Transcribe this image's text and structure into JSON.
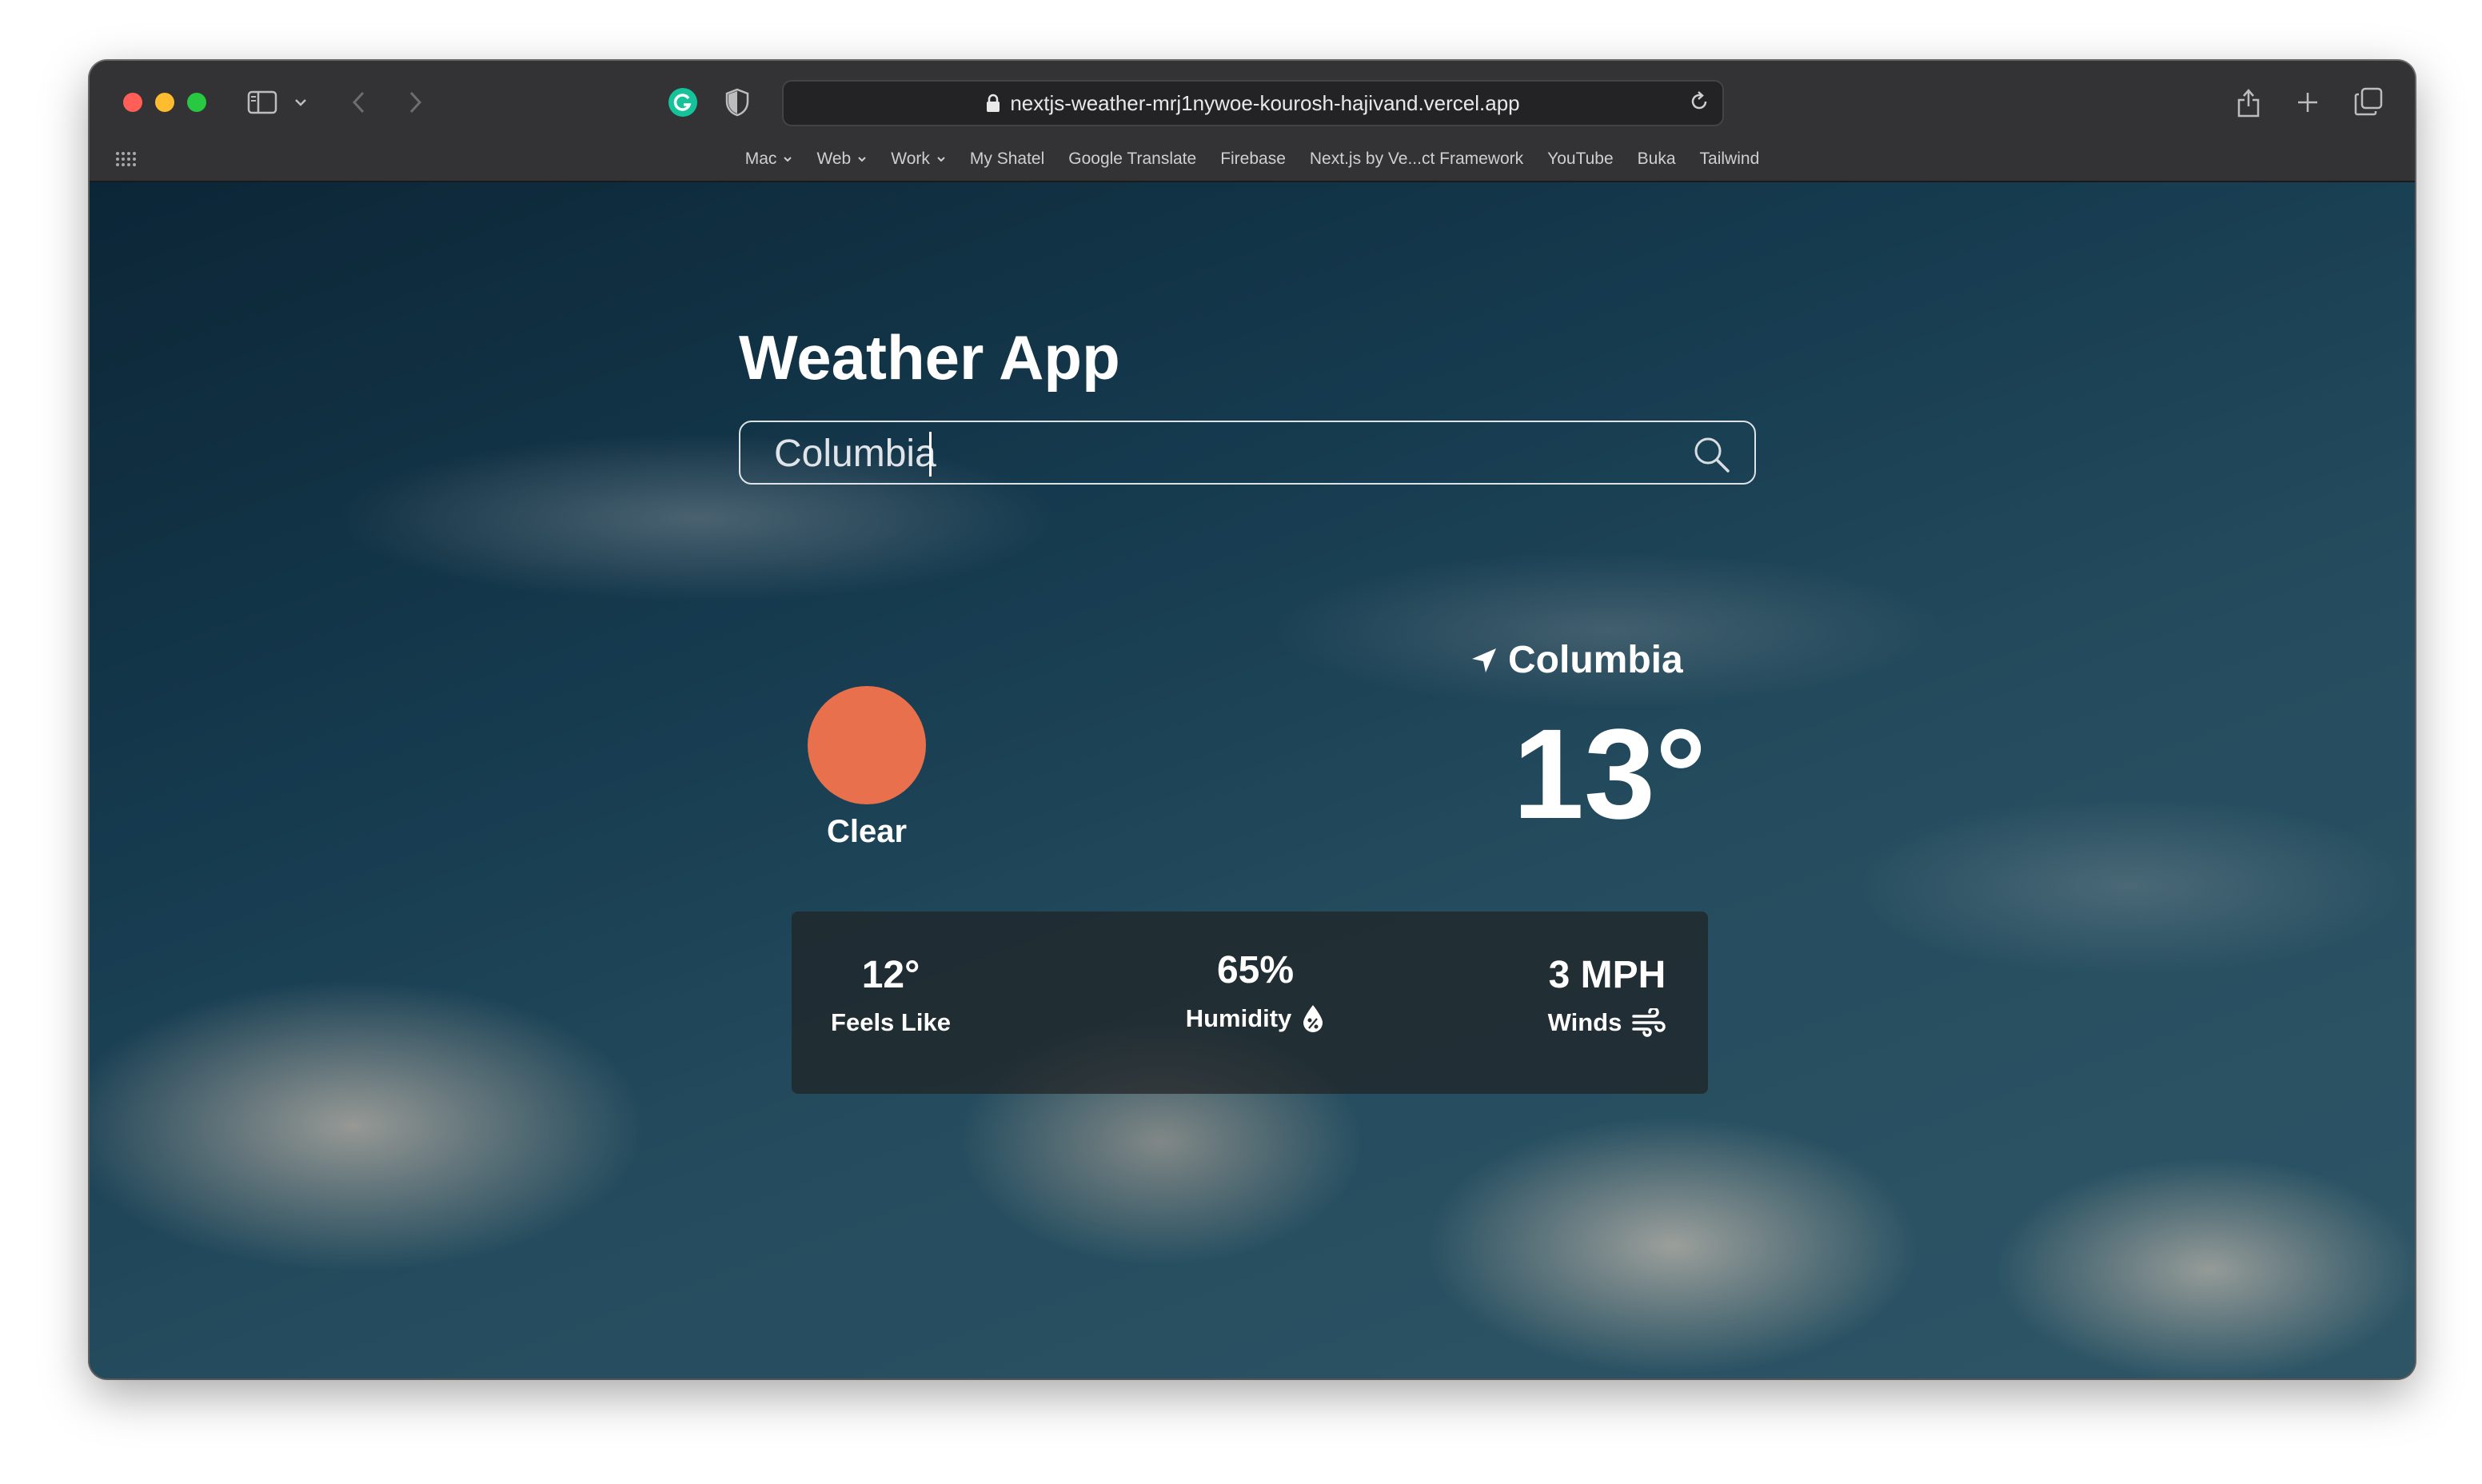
{
  "browser": {
    "url": "nextjs-weather-mrj1nywoe-kourosh-hajivand.vercel.app",
    "bookmarks": [
      {
        "label": "Mac",
        "dropdown": true
      },
      {
        "label": "Web",
        "dropdown": true
      },
      {
        "label": "Work",
        "dropdown": true
      },
      {
        "label": "My Shatel",
        "dropdown": false
      },
      {
        "label": "Google Translate",
        "dropdown": false
      },
      {
        "label": "Firebase",
        "dropdown": false
      },
      {
        "label": "Next.js by Ve...ct Framework",
        "dropdown": false
      },
      {
        "label": "YouTube",
        "dropdown": false
      },
      {
        "label": "Buka",
        "dropdown": false
      },
      {
        "label": "Tailwind",
        "dropdown": false
      }
    ],
    "icons": [
      "sidebar-icon",
      "chevron-down-icon",
      "back-icon",
      "forward-icon",
      "grammarly-icon",
      "privacy-shield-icon",
      "lock-icon",
      "reload-icon",
      "share-icon",
      "new-tab-icon",
      "tab-overview-icon",
      "grid-icon"
    ]
  },
  "app": {
    "title": "Weather App",
    "search": {
      "value": "Columbia",
      "placeholder": ""
    },
    "weather": {
      "condition": "Clear",
      "location": "Columbia",
      "temperature": "13°"
    },
    "stats": {
      "feels_like_value": "12°",
      "feels_like_label": "Feels Like",
      "humidity_value": "65%",
      "humidity_label": "Humidity",
      "wind_value": "3 MPH",
      "wind_label": "Winds"
    }
  },
  "colors": {
    "sun": "#e8704c",
    "toolbar": "#333335",
    "stats_panel": "rgba(32,34,36,0.72)"
  }
}
